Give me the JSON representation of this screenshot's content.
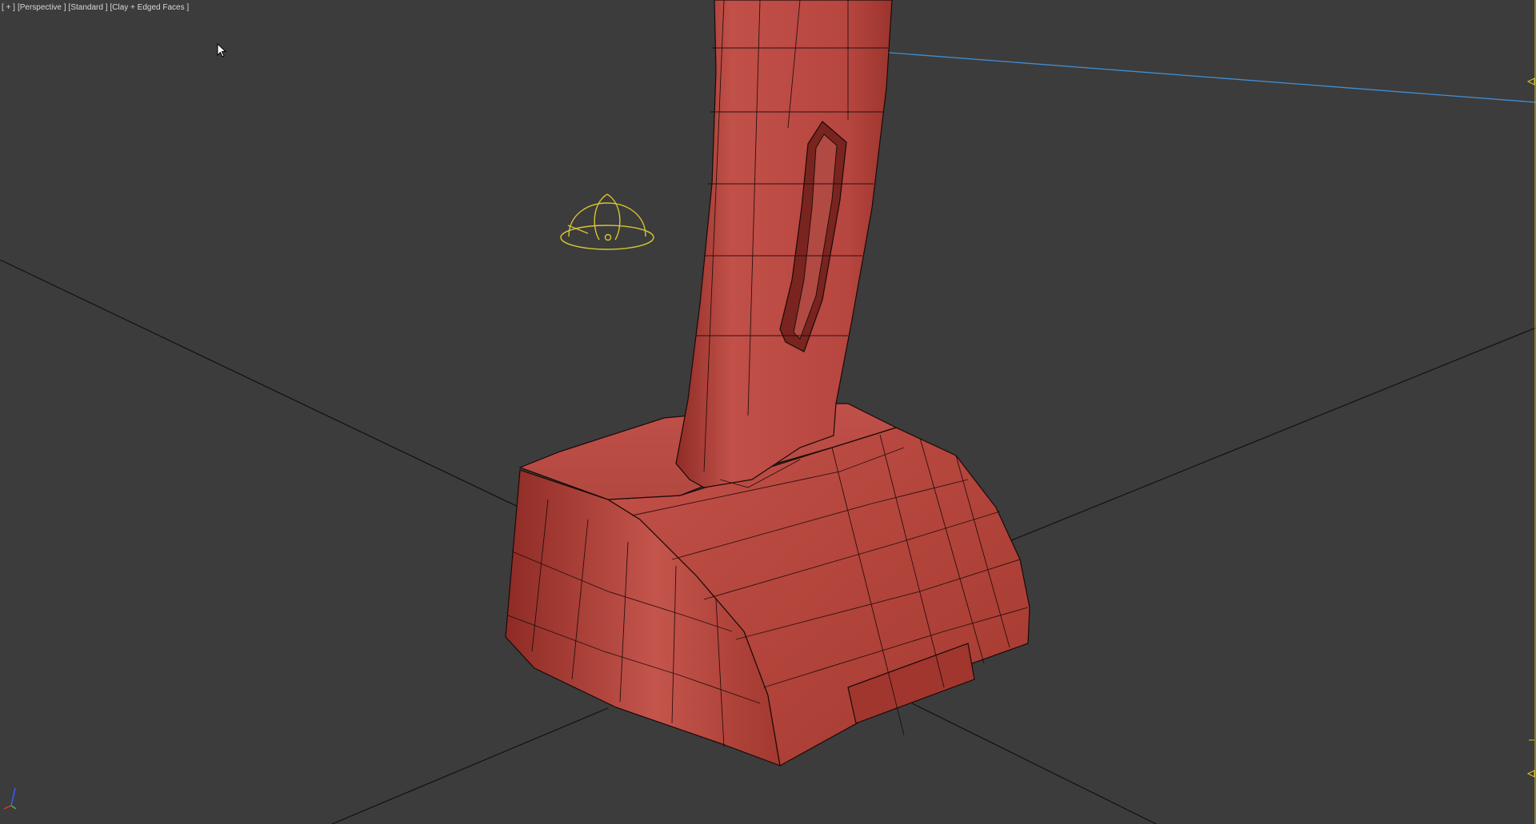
{
  "viewport": {
    "menu_plus": "[ + ]",
    "menu_view": "[Perspective ]",
    "menu_shading_preset": "[Standard ]",
    "menu_render_mode": "[Clay + Edged Faces ]"
  },
  "scene": {
    "object": "red-clay-mesh-stand",
    "gizmo": "yellow-light-wireframe-helper",
    "axis_tripod": "axis-tripod-icon"
  },
  "colors": {
    "viewport_bg": "#3c3c3c",
    "mesh_fill": "#b8463d",
    "mesh_shadow": "#7f2620",
    "mesh_edge": "#1a0a08",
    "grid_line": "#101010",
    "helper_yellow": "#d8c530",
    "selection_blue": "#3e8fd6"
  }
}
